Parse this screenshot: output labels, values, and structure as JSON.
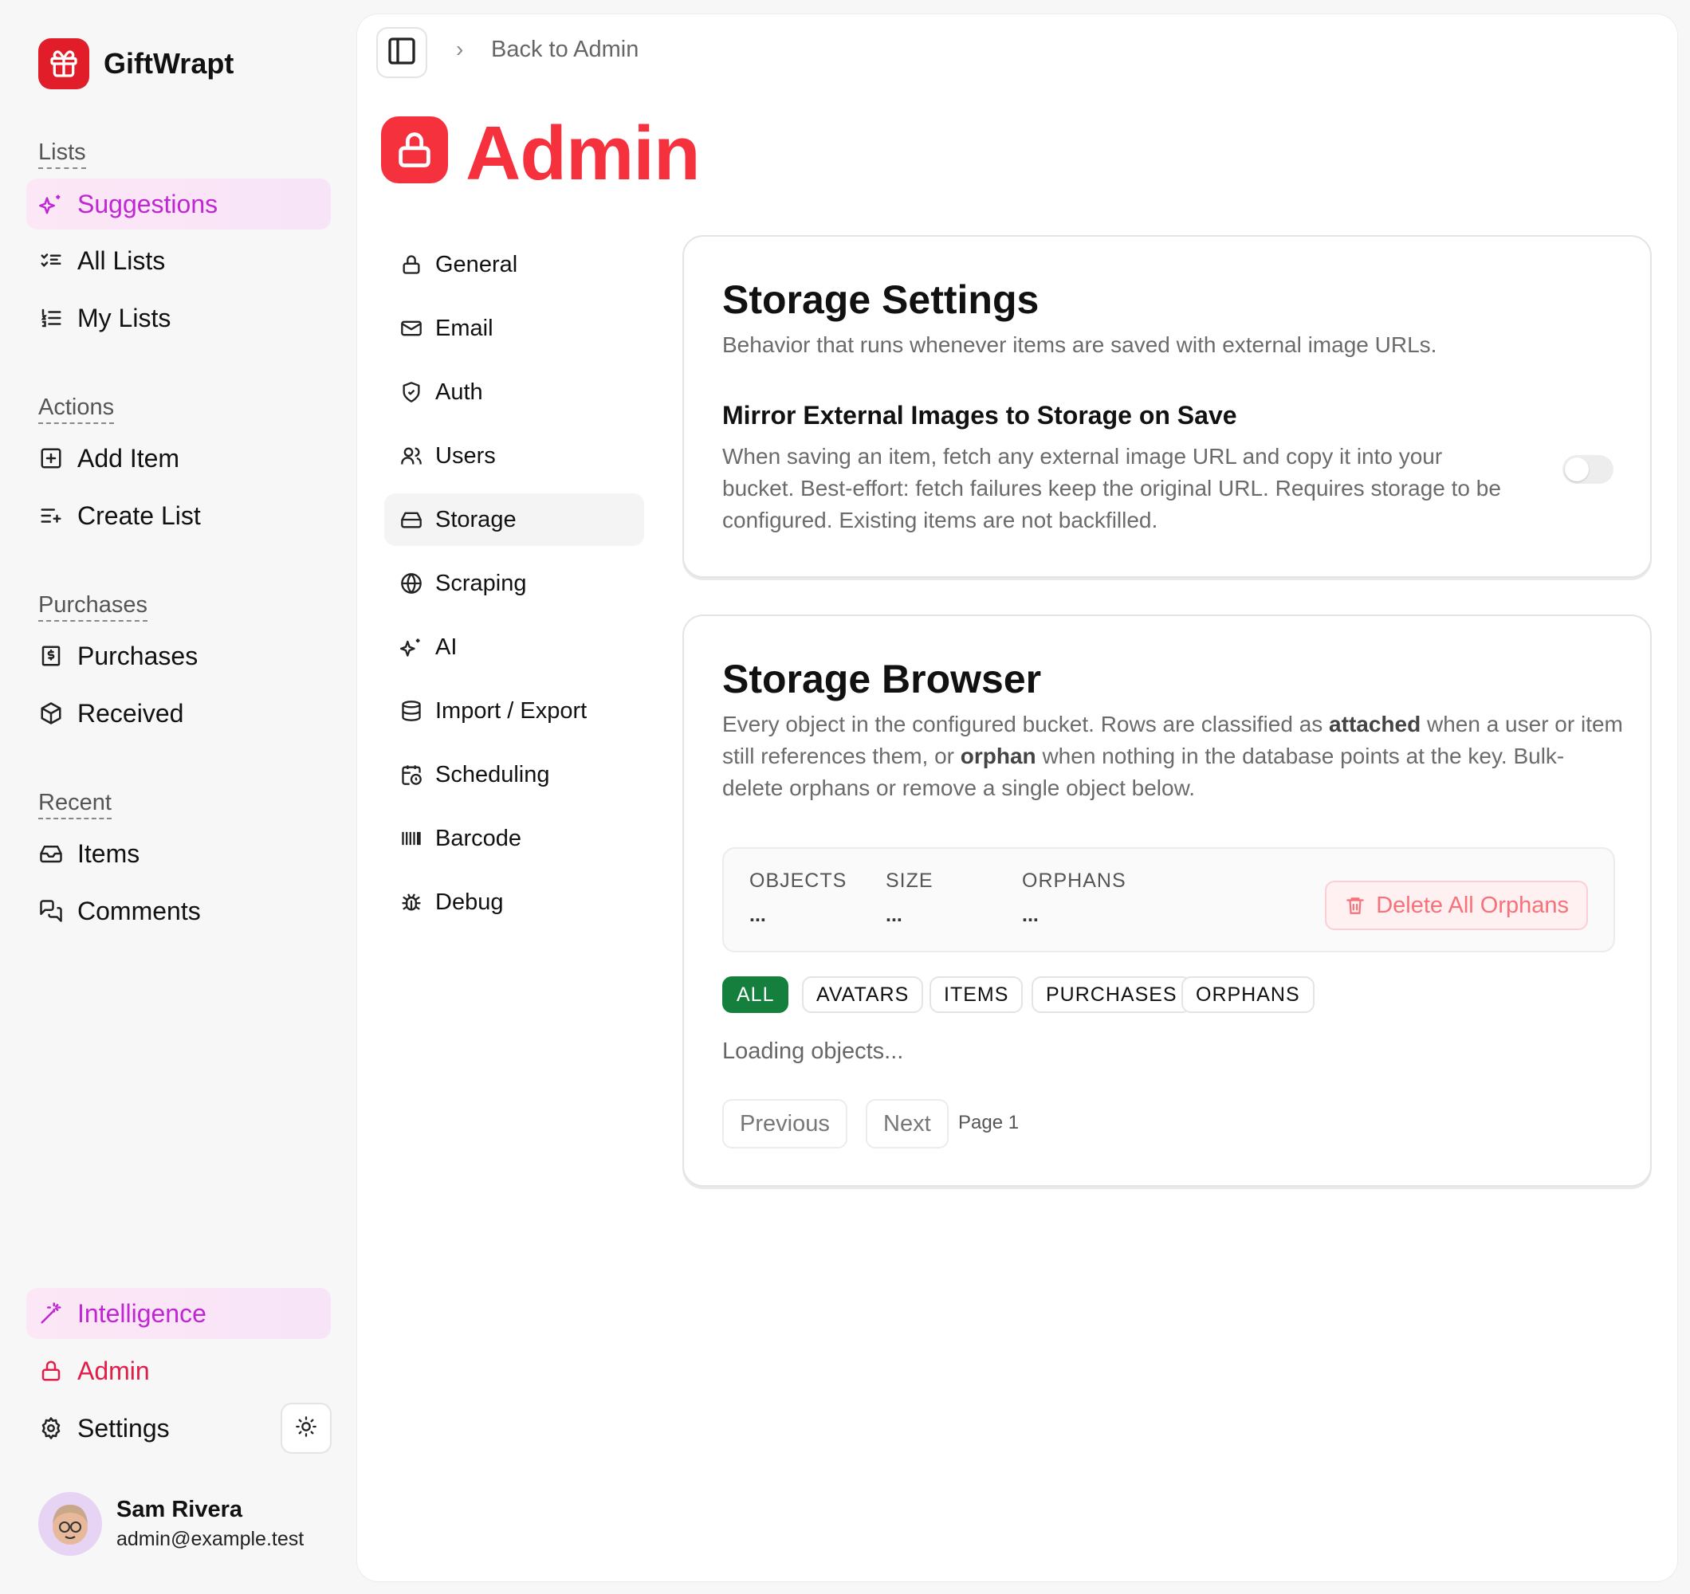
{
  "app": {
    "name": "GiftWrapt"
  },
  "sidebar": {
    "sections": {
      "lists": "Lists",
      "actions": "Actions",
      "purchases": "Purchases",
      "recent": "Recent"
    },
    "items": {
      "suggestions": "Suggestions",
      "all_lists": "All Lists",
      "my_lists": "My Lists",
      "add_item": "Add Item",
      "create_list": "Create List",
      "purchases": "Purchases",
      "received": "Received",
      "items": "Items",
      "comments": "Comments",
      "intelligence": "Intelligence",
      "admin": "Admin",
      "settings": "Settings"
    },
    "user": {
      "name": "Sam Rivera",
      "email": "admin@example.test"
    }
  },
  "header": {
    "breadcrumb": "Back to Admin",
    "title": "Admin"
  },
  "admin_nav": [
    {
      "label": "General"
    },
    {
      "label": "Email"
    },
    {
      "label": "Auth"
    },
    {
      "label": "Users"
    },
    {
      "label": "Storage"
    },
    {
      "label": "Scraping"
    },
    {
      "label": "AI"
    },
    {
      "label": "Import / Export"
    },
    {
      "label": "Scheduling"
    },
    {
      "label": "Barcode"
    },
    {
      "label": "Debug"
    }
  ],
  "storage_settings": {
    "title": "Storage Settings",
    "description": "Behavior that runs whenever items are saved with external image URLs.",
    "mirror": {
      "title": "Mirror External Images to Storage on Save",
      "description": "When saving an item, fetch any external image URL and copy it into your bucket. Best-effort: fetch failures keep the original URL. Requires storage to be configured. Existing items are not backfilled.",
      "enabled": false
    }
  },
  "storage_browser": {
    "title": "Storage Browser",
    "desc_1": "Every object in the configured bucket. Rows are classified as ",
    "desc_attached": "attached",
    "desc_2": " when a user or item still references them, or ",
    "desc_orphan": "orphan",
    "desc_3": " when nothing in the database points at the key. Bulk-delete orphans or remove a single object below.",
    "stats": {
      "objects_label": "OBJECTS",
      "objects_value": "...",
      "size_label": "SIZE",
      "size_value": "...",
      "orphans_label": "ORPHANS",
      "orphans_value": "..."
    },
    "delete_orphans_label": "Delete All Orphans",
    "filters": [
      "ALL",
      "AVATARS",
      "ITEMS",
      "PURCHASES",
      "ORPHANS"
    ],
    "active_filter": "ALL",
    "loading_text": "Loading objects...",
    "pagination": {
      "previous": "Previous",
      "next": "Next",
      "page": "Page 1"
    }
  },
  "colors": {
    "brand": "#e11d2a",
    "admin_accent": "#f5313d",
    "intelligence_accent": "#c026d3",
    "active_filter": "#15803d"
  }
}
